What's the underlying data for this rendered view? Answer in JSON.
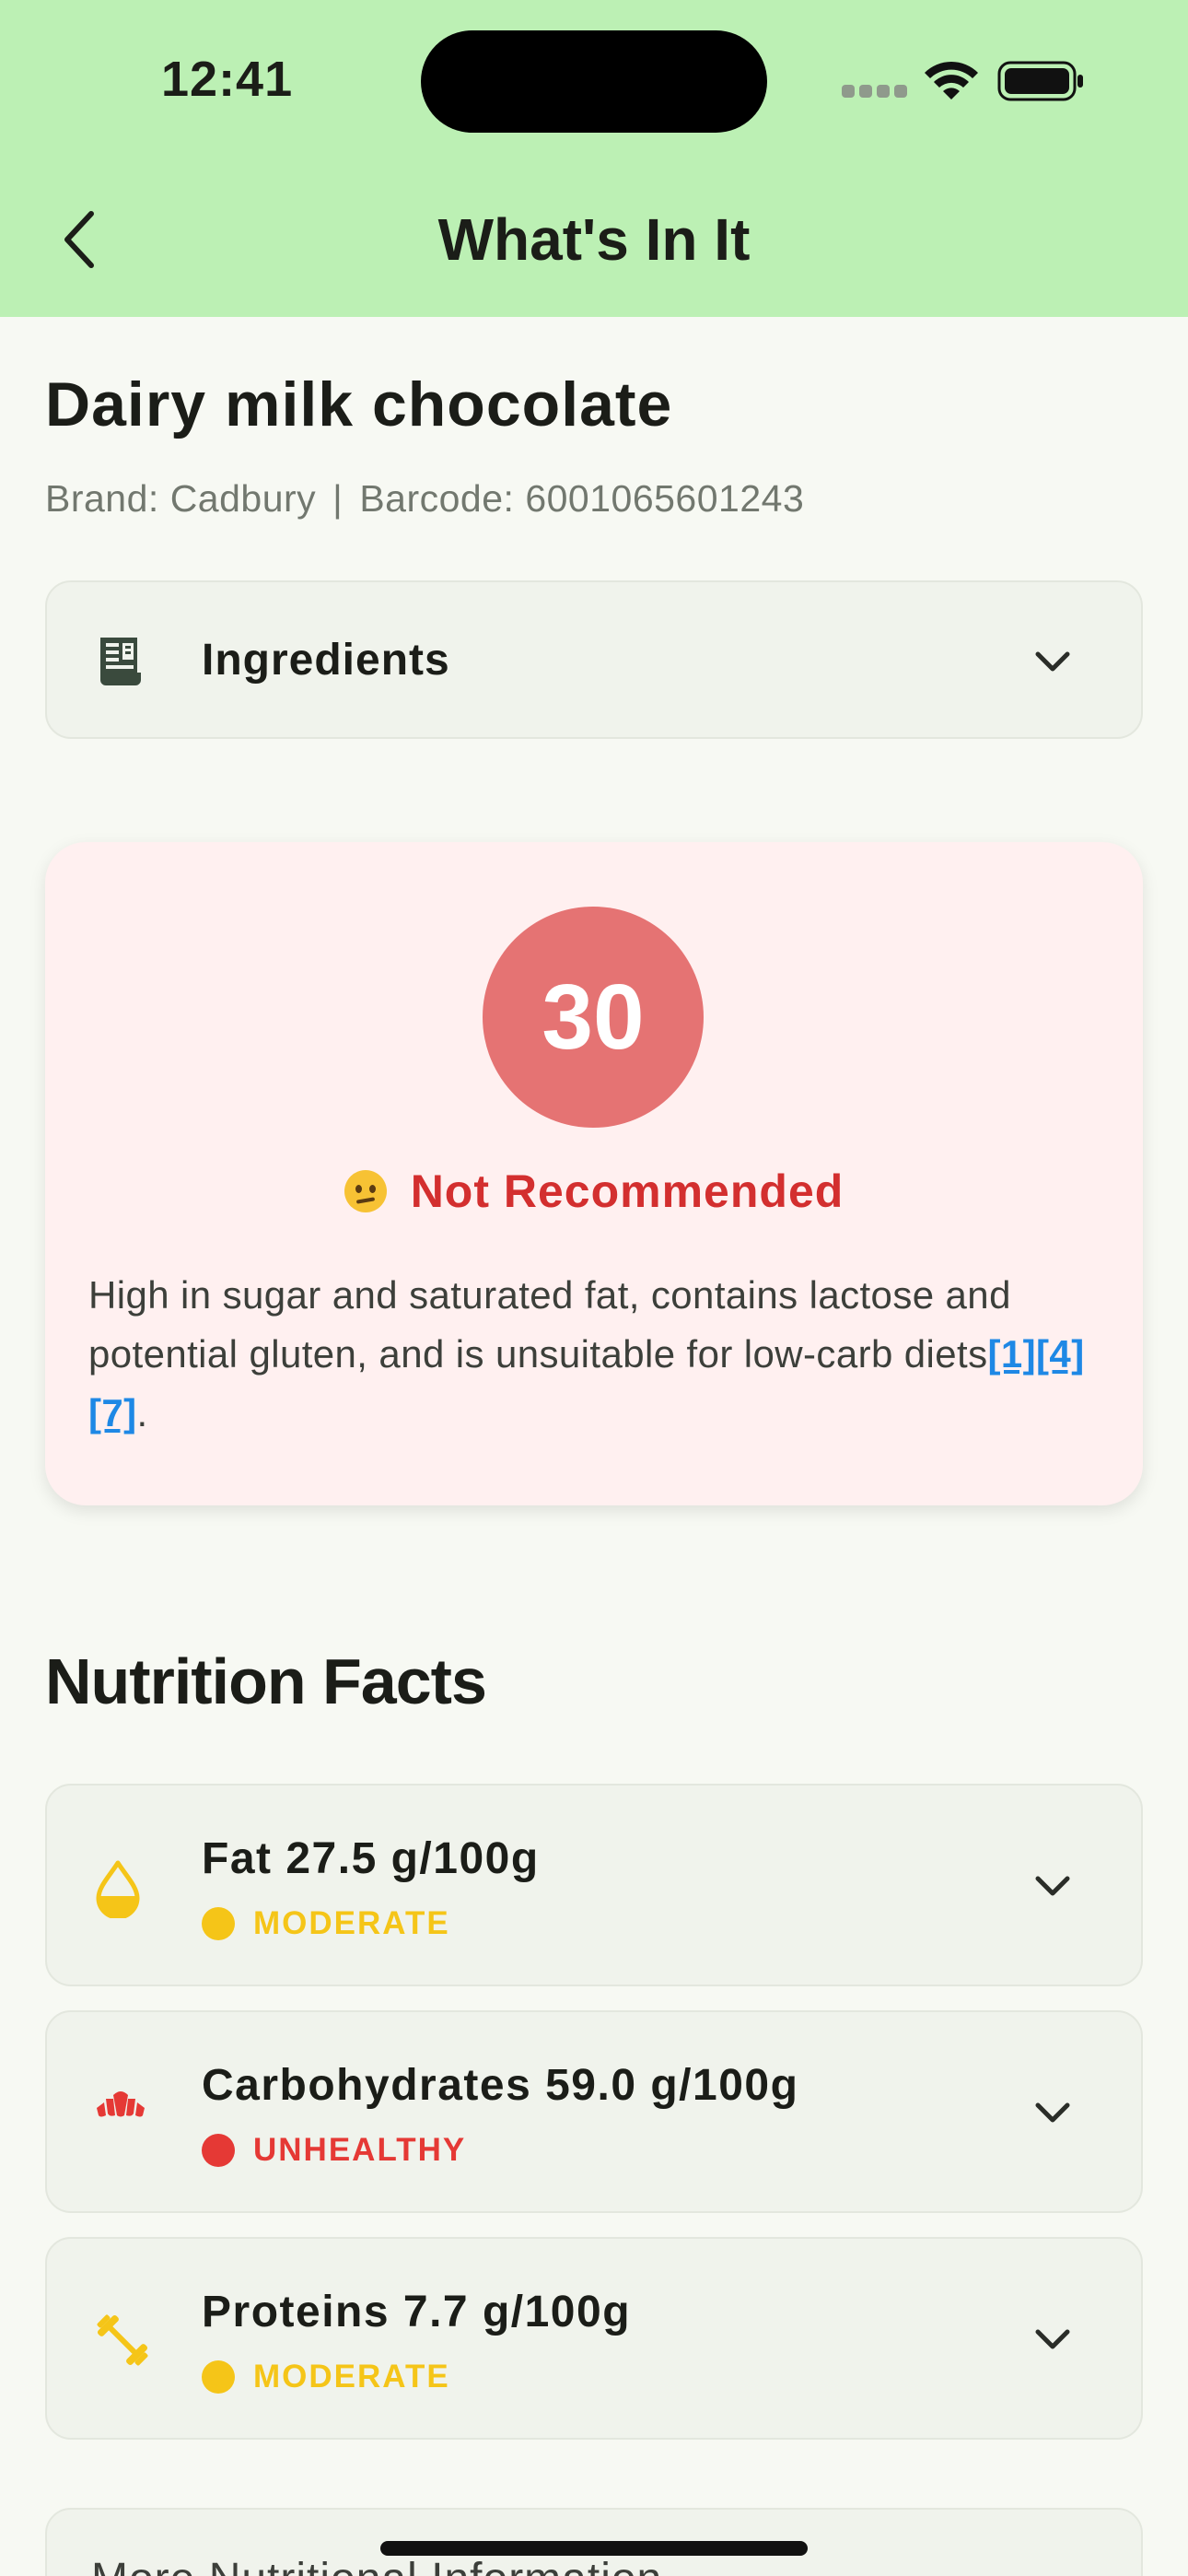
{
  "status_bar": {
    "time": "12:41"
  },
  "header": {
    "title": "What's In It",
    "background": "#bcf0b4"
  },
  "product": {
    "name": "Dairy milk chocolate",
    "brand": "Brand: Cadbury",
    "separator": "|",
    "barcode": "Barcode: 6001065601243"
  },
  "ingredients": {
    "label": "Ingredients",
    "icon": "receipt-icon"
  },
  "score": {
    "value": "30",
    "verdict": "Not Recommended",
    "verdict_emoji": "confused-face",
    "color": "#e57373",
    "verdict_color": "#d32f2f",
    "summary_text": "High in sugar and saturated fat, contains lactose and potential gluten, and is unsuitable for low-carb diets",
    "refs": [
      "[1]",
      "[4]",
      "[7]"
    ],
    "summary_end": "."
  },
  "nutrition": {
    "section_title": "Nutrition Facts",
    "items": [
      {
        "title": "Fat 27.5 g/100g",
        "status": "MODERATE",
        "status_color": "#f5c518",
        "icon": "drop-icon"
      },
      {
        "title": "Carbohydrates 59.0 g/100g",
        "status": "UNHEALTHY",
        "status_color": "#e53935",
        "icon": "croissant-icon"
      },
      {
        "title": "Proteins 7.7 g/100g",
        "status": "MODERATE",
        "status_color": "#f5c518",
        "icon": "dumbbell-icon"
      }
    ]
  },
  "more_info": {
    "label": "More Nutritional Information"
  }
}
